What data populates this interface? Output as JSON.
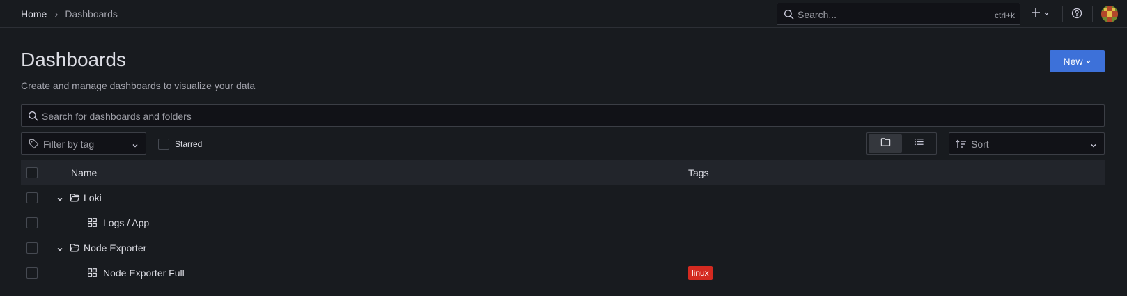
{
  "breadcrumb": {
    "home": "Home",
    "separator": "›",
    "current": "Dashboards"
  },
  "topbar": {
    "search_placeholder": "Search...",
    "search_shortcut": "ctrl+k"
  },
  "page": {
    "title": "Dashboards",
    "subtitle": "Create and manage dashboards to visualize your data",
    "new_button_label": "New"
  },
  "search": {
    "placeholder": "Search for dashboards and folders"
  },
  "filters": {
    "tag_placeholder": "Filter by tag",
    "starred_label": "Starred",
    "sort_placeholder": "Sort"
  },
  "table": {
    "columns": [
      "Name",
      "Tags"
    ],
    "rows": [
      {
        "type": "folder",
        "name": "Loki",
        "expanded": true,
        "tags": []
      },
      {
        "type": "dashboard",
        "name": "Logs / App",
        "tags": []
      },
      {
        "type": "folder",
        "name": "Node Exporter",
        "expanded": true,
        "tags": []
      },
      {
        "type": "dashboard",
        "name": "Node Exporter Full",
        "tags": [
          "linux"
        ]
      }
    ]
  },
  "colors": {
    "background": "#181b1f",
    "primary": "#3d71d9",
    "tag_linux": "#d42a20"
  },
  "icons": {
    "search": "search-icon",
    "plus": "plus-icon",
    "help": "help-circle-icon",
    "tag": "tag-icon",
    "folder": "folder-open-icon",
    "dashboard": "apps-grid-icon",
    "list": "list-icon",
    "sort": "sort-amount-icon"
  }
}
